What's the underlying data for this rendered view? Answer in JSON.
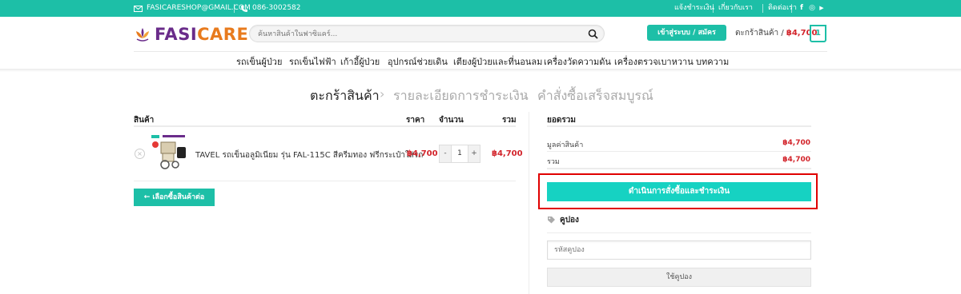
{
  "topbar": {
    "email": "FASICARESHOP@GMAIL.COM",
    "phone": "086-3002582",
    "links": [
      "แจ้งชำระเงิน",
      "เกี่ยวกับเรา",
      "ติดต่อเรา"
    ],
    "social": [
      "f",
      "◎",
      "▶"
    ]
  },
  "header": {
    "logo_part1": "FASI",
    "logo_part2": "CARE",
    "search_placeholder": "ค้นหาสินค้าในฟาซิแคร์...",
    "login_label": "เข้าสู่ระบบ / สมัครสมาชิก",
    "cart_label": "ตะกร้าสินค้า /",
    "cart_amount": "฿4,700",
    "cart_count": "1"
  },
  "nav": {
    "items": [
      "รถเข็นผู้ป่วย",
      "รถเข็นไฟฟ้า",
      "เก้าอี้ผู้ป่วย",
      "อุปกรณ์ช่วยเดิน",
      "เตียงผู้ป่วยและที่นอนลม",
      "เครื่องวัดความดัน",
      "เครื่องตรวจเบาหวาน",
      "บทความ"
    ]
  },
  "steps": {
    "step1": "ตะกร้าสินค้า",
    "step2": "รายละเอียดการชำระเงิน",
    "step3": "คำสั่งซื้อเสร็จสมบูรณ์"
  },
  "cart": {
    "headers": {
      "product": "สินค้า",
      "price": "ราคา",
      "qty": "จำนวน",
      "total": "รวม"
    },
    "item": {
      "name": "TAVEL รถเข็นอลูมิเนียม รุ่น FAL-115C สีครีมทอง ฟรีกระเป๋าใส่รถ",
      "price": "฿4,700",
      "qty_minus": "-",
      "qty": "1",
      "qty_plus": "+",
      "total": "฿4,700",
      "remove": "×"
    },
    "continue_label": "← เลือกซื้อสินค้าต่อ"
  },
  "totals": {
    "title": "ยอดรวม",
    "subtotal_label": "มูลค่าสินค้า",
    "subtotal_value": "฿4,700",
    "total_label": "รวม",
    "total_value": "฿4,700",
    "checkout_label": "ดำเนินการสั่งซื้อและชำระเงิน",
    "coupon_title": "คูปอง",
    "coupon_placeholder": "รหัสคูปอง",
    "coupon_apply": "ใช้คูปอง"
  },
  "colors": {
    "brand": "#1dbfa7",
    "checkout": "#16d2c2",
    "price": "#d2232a",
    "highlight": "#e00000"
  }
}
